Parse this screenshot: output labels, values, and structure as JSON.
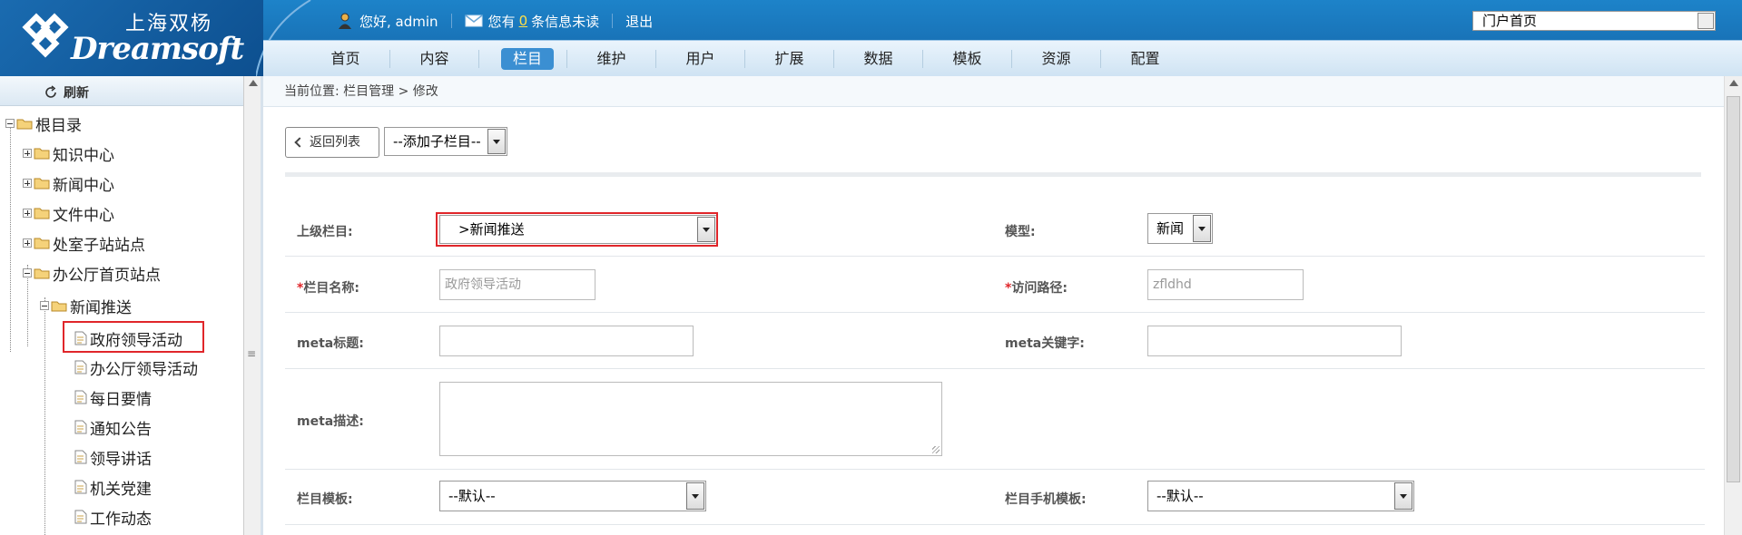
{
  "header": {
    "logo_cn": "上海双杨",
    "logo_en": "Dreamsoft",
    "greeting": "您好, admin",
    "messages_prefix": "您有",
    "unread_count": "0",
    "messages_suffix": "条信息未读",
    "logout": "退出",
    "portal_select": "门户首页"
  },
  "nav": [
    "首页",
    "内容",
    "栏目",
    "维护",
    "用户",
    "扩展",
    "数据",
    "模板",
    "资源",
    "配置"
  ],
  "nav_active": "栏目",
  "sidebar": {
    "refresh": "刷新",
    "root": "根目录",
    "items": [
      "知识中心",
      "新闻中心",
      "文件中心",
      "处室子站站点",
      "办公厅首页站点"
    ],
    "sub_parent": "新闻推送",
    "leaves": [
      "政府领导活动",
      "办公厅领导活动",
      "每日要情",
      "通知公告",
      "领导讲话",
      "机关党建",
      "工作动态"
    ]
  },
  "breadcrumb": "当前位置: 栏目管理 > 修改",
  "toolbar": {
    "back": "返回列表",
    "add_child": "--添加子栏目--"
  },
  "form": {
    "parent_label": "上级栏目:",
    "parent_value": ">新闻推送",
    "model_label": "模型:",
    "model_value": "新闻",
    "name_label": "栏目名称:",
    "name_value": "政府领导活动",
    "path_label": "访问路径:",
    "path_value": "zfldhd",
    "meta_title_label": "meta标题:",
    "meta_keywords_label": "meta关键字:",
    "meta_desc_label": "meta描述:",
    "template_label": "栏目模板:",
    "template_value": "--默认--",
    "mobile_template_label": "栏目手机模板:",
    "mobile_template_value": "--默认--",
    "required_mark": "*"
  },
  "colors": {
    "header_blue": "#1565a8",
    "nav_active": "#3b8fd2",
    "highlight_red": "#e0262a",
    "unread_yellow": "#ffe14a"
  }
}
